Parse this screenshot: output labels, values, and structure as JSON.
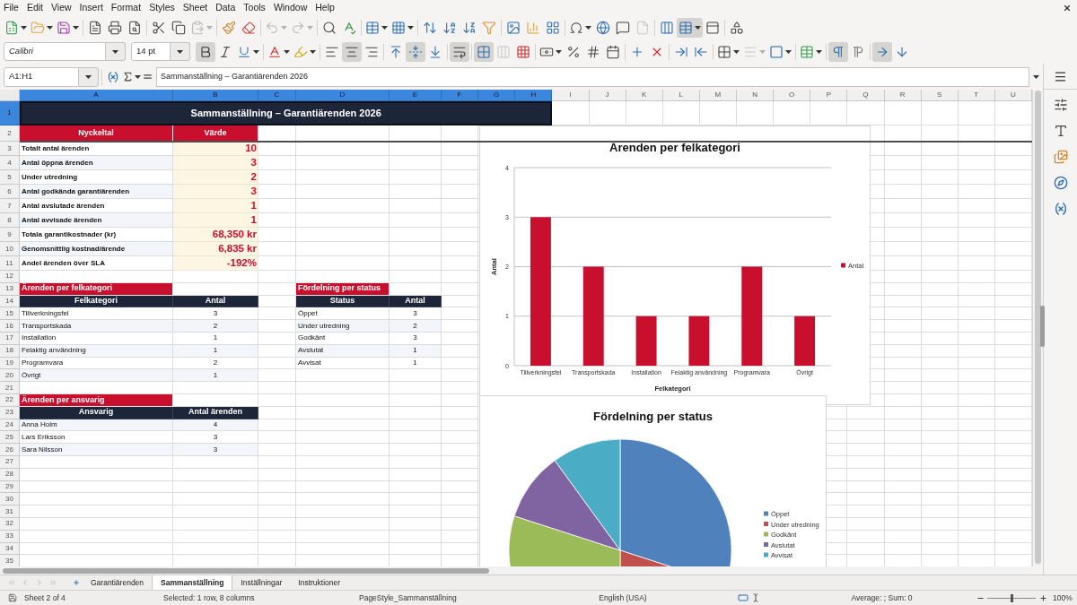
{
  "menu_bar": {
    "items": [
      "File",
      "Edit",
      "View",
      "Insert",
      "Format",
      "Styles",
      "Sheet",
      "Data",
      "Tools",
      "Window",
      "Help"
    ]
  },
  "standard_toolbar": {
    "groups": [
      [
        {
          "kind": "new",
          "on": false,
          "disabled": false
        },
        {
          "kind": "open",
          "on": false,
          "disabled": false
        },
        {
          "kind": "save",
          "on": false,
          "disabled": false
        }
      ],
      [
        {
          "kind": "pdf",
          "on": false,
          "disabled": false
        },
        {
          "kind": "print",
          "on": false,
          "disabled": false
        },
        {
          "kind": "preview",
          "on": false,
          "disabled": false
        }
      ],
      [
        {
          "kind": "cut",
          "on": false,
          "disabled": false
        },
        {
          "kind": "copy",
          "on": false,
          "disabled": false
        },
        {
          "kind": "paste",
          "on": false,
          "disabled": true
        }
      ],
      [
        {
          "kind": "clone",
          "on": false,
          "disabled": false
        },
        {
          "kind": "clear",
          "on": false,
          "disabled": false
        }
      ],
      [
        {
          "kind": "undo",
          "on": false,
          "disabled": true
        },
        {
          "kind": "redo",
          "on": false,
          "disabled": true
        }
      ],
      [
        {
          "kind": "find",
          "on": false,
          "disabled": false
        },
        {
          "kind": "spelling",
          "on": false,
          "disabled": false
        }
      ],
      [
        {
          "kind": "rows",
          "on": false,
          "disabled": false
        },
        {
          "kind": "columns",
          "on": false,
          "disabled": false
        }
      ],
      [
        {
          "kind": "sort",
          "on": false,
          "disabled": false
        },
        {
          "kind": "ascending",
          "on": false,
          "disabled": false
        },
        {
          "kind": "descending",
          "on": false,
          "disabled": false
        },
        {
          "kind": "autofilter",
          "on": false,
          "disabled": false
        }
      ],
      [
        {
          "kind": "image",
          "on": false,
          "disabled": false
        },
        {
          "kind": "chart",
          "on": false,
          "disabled": false
        },
        {
          "kind": "pivot",
          "on": false,
          "disabled": false
        }
      ],
      [
        {
          "kind": "symbol",
          "on": false,
          "disabled": false
        },
        {
          "kind": "hyperlink",
          "on": false,
          "disabled": false
        },
        {
          "kind": "comment",
          "on": false,
          "disabled": false
        },
        {
          "kind": "headerfooter",
          "on": false,
          "disabled": true
        }
      ],
      [
        {
          "kind": "printarea",
          "on": false,
          "disabled": false
        },
        {
          "kind": "freeze",
          "on": true,
          "disabled": false
        },
        {
          "kind": "split",
          "on": false,
          "disabled": false
        }
      ],
      [
        {
          "kind": "draw",
          "on": false,
          "disabled": false
        }
      ]
    ]
  },
  "formatting_toolbar": {
    "font_name": "Calibri",
    "font_size": "14 pt",
    "groups": [
      [
        {
          "kind": "bold",
          "on": true,
          "disabled": false
        },
        {
          "kind": "italic",
          "on": false,
          "disabled": false
        },
        {
          "kind": "underline",
          "on": false,
          "disabled": false
        }
      ],
      [
        {
          "kind": "fontcolor",
          "on": false,
          "disabled": false
        },
        {
          "kind": "highlight",
          "on": false,
          "disabled": false
        }
      ],
      [
        {
          "kind": "left",
          "on": false,
          "disabled": false
        },
        {
          "kind": "center",
          "on": true,
          "disabled": false
        },
        {
          "kind": "right",
          "on": false,
          "disabled": false
        }
      ],
      [
        {
          "kind": "top",
          "on": false,
          "disabled": false
        },
        {
          "kind": "middle",
          "on": true,
          "disabled": false
        },
        {
          "kind": "bottom",
          "on": false,
          "disabled": false
        }
      ],
      [
        {
          "kind": "wrap",
          "on": true,
          "disabled": false
        }
      ],
      [
        {
          "kind": "mergecenter",
          "on": true,
          "disabled": false
        },
        {
          "kind": "merge",
          "on": false,
          "disabled": true
        },
        {
          "kind": "unmerge",
          "on": false,
          "disabled": false
        }
      ],
      [
        {
          "kind": "currency",
          "on": false,
          "disabled": false
        },
        {
          "kind": "percent",
          "on": false,
          "disabled": false
        },
        {
          "kind": "number",
          "on": false,
          "disabled": false
        },
        {
          "kind": "date",
          "on": false,
          "disabled": false
        }
      ],
      [
        {
          "kind": "adddecimal",
          "on": false,
          "disabled": false
        },
        {
          "kind": "deletedecimal",
          "on": false,
          "disabled": false
        }
      ],
      [
        {
          "kind": "indent",
          "on": false,
          "disabled": false
        },
        {
          "kind": "outdent",
          "on": false,
          "disabled": false
        }
      ],
      [
        {
          "kind": "borders",
          "on": false,
          "disabled": false
        },
        {
          "kind": "borderstyle",
          "on": false,
          "disabled": true
        },
        {
          "kind": "bordercolor",
          "on": false,
          "disabled": false
        }
      ],
      [
        {
          "kind": "conditional",
          "on": false,
          "disabled": false
        }
      ],
      [
        {
          "kind": "ltr",
          "on": true,
          "disabled": false
        },
        {
          "kind": "rtl",
          "on": false,
          "disabled": false
        }
      ],
      [
        {
          "kind": "horizontal",
          "on": true,
          "disabled": false
        },
        {
          "kind": "vertical",
          "on": false,
          "disabled": false
        }
      ]
    ]
  },
  "formula_bar": {
    "name_box": "A1:H1",
    "formula": "Sammanställning – Garantiärenden 2026"
  },
  "sheet": {
    "columns": [
      {
        "label": "A",
        "selected": true
      },
      {
        "label": "B",
        "selected": true
      },
      {
        "label": "C",
        "selected": true
      },
      {
        "label": "D",
        "selected": true
      },
      {
        "label": "E",
        "selected": true
      },
      {
        "label": "F",
        "selected": true
      },
      {
        "label": "G",
        "selected": true
      },
      {
        "label": "H",
        "selected": true
      },
      {
        "label": "I",
        "selected": false
      },
      {
        "label": "J",
        "selected": false
      },
      {
        "label": "K",
        "selected": false
      },
      {
        "label": "L",
        "selected": false
      },
      {
        "label": "M",
        "selected": false
      },
      {
        "label": "N",
        "selected": false
      },
      {
        "label": "O",
        "selected": false
      },
      {
        "label": "P",
        "selected": false
      },
      {
        "label": "Q",
        "selected": false
      },
      {
        "label": "R",
        "selected": false
      },
      {
        "label": "S",
        "selected": false
      },
      {
        "label": "T",
        "selected": false
      },
      {
        "label": "U",
        "selected": false
      }
    ],
    "rows": [
      {
        "label": "1",
        "selected": true
      },
      {
        "label": "2",
        "selected": false
      },
      {
        "label": "3",
        "selected": false
      },
      {
        "label": "4",
        "selected": false
      },
      {
        "label": "5",
        "selected": false
      },
      {
        "label": "6",
        "selected": false
      },
      {
        "label": "7",
        "selected": false
      },
      {
        "label": "8",
        "selected": false
      },
      {
        "label": "9",
        "selected": false
      },
      {
        "label": "10",
        "selected": false
      },
      {
        "label": "11",
        "selected": false
      },
      {
        "label": "12",
        "selected": false
      },
      {
        "label": "13",
        "selected": false
      },
      {
        "label": "14",
        "selected": false
      },
      {
        "label": "15",
        "selected": false
      },
      {
        "label": "16",
        "selected": false
      },
      {
        "label": "17",
        "selected": false
      },
      {
        "label": "18",
        "selected": false
      },
      {
        "label": "19",
        "selected": false
      },
      {
        "label": "20",
        "selected": false
      },
      {
        "label": "21",
        "selected": false
      },
      {
        "label": "22",
        "selected": false
      },
      {
        "label": "23",
        "selected": false
      },
      {
        "label": "24",
        "selected": false
      },
      {
        "label": "25",
        "selected": false
      },
      {
        "label": "26",
        "selected": false
      },
      {
        "label": "27",
        "selected": false
      },
      {
        "label": "28",
        "selected": false
      },
      {
        "label": "29",
        "selected": false
      },
      {
        "label": "30",
        "selected": false
      },
      {
        "label": "31",
        "selected": false
      },
      {
        "label": "32",
        "selected": false
      },
      {
        "label": "33",
        "selected": false
      },
      {
        "label": "34",
        "selected": false
      },
      {
        "label": "35",
        "selected": false
      }
    ],
    "title": "Sammanställning – Garantiärenden 2026",
    "kpi_table": {
      "headers": [
        "Nyckeltal",
        "Värde"
      ],
      "rows": [
        {
          "label": "Totalt antal ärenden",
          "value": "10"
        },
        {
          "label": "Antal öppna ärenden",
          "value": "3"
        },
        {
          "label": "Under utredning",
          "value": "2"
        },
        {
          "label": "Antal godkända garantiärenden",
          "value": "3"
        },
        {
          "label": "Antal avslutade ärenden",
          "value": "1"
        },
        {
          "label": "Antal avvisade ärenden",
          "value": "1"
        },
        {
          "label": "Totala garantikostnader (kr)",
          "value": "68,350 kr"
        },
        {
          "label": "Genomsnittlig kostnad/ärende",
          "value": "6,835 kr"
        },
        {
          "label": "Andel ärenden över SLA",
          "value": "-192%"
        }
      ]
    },
    "tables": [
      {
        "title": "Ärenden per felkategori",
        "headers": [
          "Felkategori",
          "Antal"
        ],
        "rows": [
          [
            "Tillverkningsfel",
            "3"
          ],
          [
            "Transportskada",
            "2"
          ],
          [
            "Installation",
            "1"
          ],
          [
            "Felaktig användning",
            "1"
          ],
          [
            "Programvara",
            "2"
          ],
          [
            "Övrigt",
            "1"
          ]
        ]
      },
      {
        "title": "Fördelning per status",
        "headers": [
          "Status",
          "Antal"
        ],
        "rows": [
          [
            "Öppet",
            "3"
          ],
          [
            "Under utredning",
            "2"
          ],
          [
            "Godkänt",
            "3"
          ],
          [
            "Avslutat",
            "1"
          ],
          [
            "Avvisat",
            "1"
          ]
        ]
      },
      {
        "title": "Ärenden per ansvarig",
        "headers": [
          "Ansvarig",
          "Antal ärenden"
        ],
        "rows": [
          [
            "Anna Holm",
            "4"
          ],
          [
            "Lars Eriksson",
            "3"
          ],
          [
            "Sara Nilsson",
            "3"
          ]
        ]
      }
    ],
    "charts": [
      {
        "chart_data": {
          "type": "bar",
          "title": "Ärenden per felkategori",
          "xlabel": "Felkategori",
          "ylabel": "Antal",
          "categories": [
            "Tillverkningsfel",
            "Transportskada",
            "Installation",
            "Felaktig användning",
            "Programvara",
            "Övrigt"
          ],
          "series": [
            {
              "name": "Antal",
              "color": "#c8102e",
              "values": [
                3,
                2,
                1,
                1,
                2,
                1
              ]
            }
          ],
          "ylim": [
            0,
            4
          ],
          "yticks": [
            0,
            1,
            2,
            3,
            4
          ],
          "grid": true,
          "legend": "right"
        }
      },
      {
        "chart_data": {
          "type": "pie",
          "title": "Fördelning per status",
          "categories": [
            "Öppet",
            "Under utredning",
            "Godkänt",
            "Avslutat",
            "Avvisat"
          ],
          "series": [
            {
              "values": [
                30,
                20,
                30,
                10,
                10
              ],
              "colors": [
                "#4f81bd",
                "#c0504d",
                "#9bbb59",
                "#8064a2",
                "#4bacc6"
              ]
            }
          ],
          "legend": "right"
        }
      }
    ]
  },
  "sheet_tabs": [
    {
      "label": "Garantiärenden",
      "selected": false
    },
    {
      "label": "Sammanställning",
      "selected": true
    },
    {
      "label": "Inställningar",
      "selected": false
    },
    {
      "label": "Instruktioner",
      "selected": false
    }
  ],
  "status_bar": {
    "sheet_position": "Sheet 2 of 4",
    "selection": "Selected: 1 row, 8 columns",
    "page_style": "PageStyle_Sammanställning",
    "language": "English (USA)",
    "summary": "Average: ; Sum: 0",
    "zoom": {
      "level": 0.5,
      "reading": "100%"
    }
  }
}
